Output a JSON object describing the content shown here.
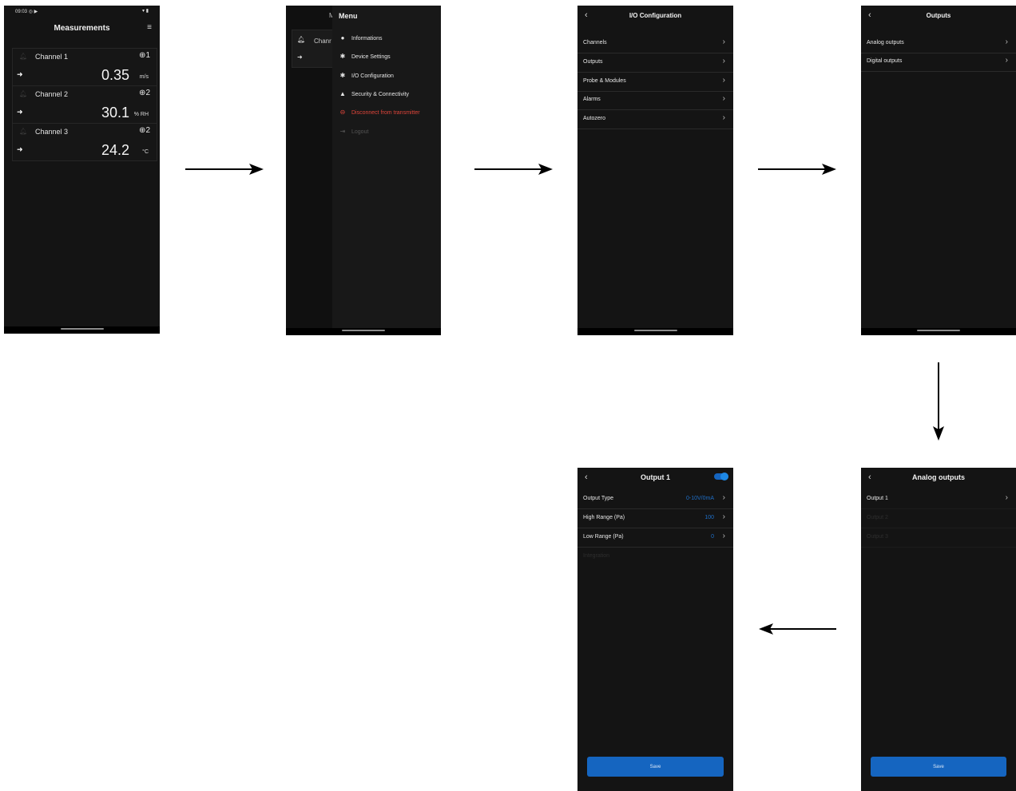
{
  "screen1": {
    "status_time": "09:03",
    "title": "Measurements",
    "channels": [
      {
        "name": "Channel 1",
        "value": "0.35",
        "unit": "m/s",
        "badge": "1"
      },
      {
        "name": "Channel 2",
        "value": "30.1",
        "unit": "% RH",
        "badge": "2"
      },
      {
        "name": "Channel 3",
        "value": "24.2",
        "unit": "°C",
        "badge": "2"
      }
    ]
  },
  "screen2": {
    "title": "Menu",
    "behind_title_fragment": "M",
    "behind_channel_fragment": "Chanr",
    "items": [
      {
        "label": "Informations",
        "icon": "info-icon"
      },
      {
        "label": "Device Settings",
        "icon": "gear-icon"
      },
      {
        "label": "I/O Configuration",
        "icon": "gear-icon"
      },
      {
        "label": "Security & Connectivity",
        "icon": "warning-icon"
      },
      {
        "label": "Disconnect from transmitter",
        "icon": "link-icon"
      },
      {
        "label": "Logout",
        "icon": "logout-icon"
      }
    ],
    "disconnect_color": "#e0453a"
  },
  "screen3": {
    "title": "I/O Configuration",
    "items": [
      "Channels",
      "Outputs",
      "Probe & Modules",
      "Alarms",
      "Autozero"
    ]
  },
  "screen4": {
    "title": "Outputs",
    "items": [
      "Analog outputs",
      "Digital outputs"
    ]
  },
  "screen5": {
    "title": "Analog outputs",
    "items": [
      "Output 1",
      "Output 2",
      "Output 3"
    ],
    "save_label": "Save"
  },
  "screen6": {
    "title": "Output 1",
    "toggle_on": true,
    "fields": [
      {
        "label": "Output Type",
        "value": "0-10V/0mA"
      },
      {
        "label": "High Range (Pa)",
        "value": "100"
      },
      {
        "label": "Low Range (Pa)",
        "value": "0"
      }
    ],
    "extra_label": "Integration",
    "save_label": "Save"
  },
  "colors": {
    "accent": "#1565c0",
    "background": "#141414"
  }
}
